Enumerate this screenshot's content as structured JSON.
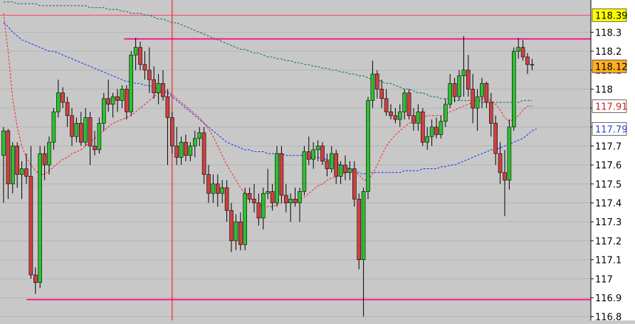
{
  "chart_data": {
    "type": "candlestick",
    "title": "",
    "xlabel": "",
    "ylabel": "",
    "ylim": [
      116.78,
      118.47
    ],
    "y_ticks": [
      "118.3",
      "118.2",
      "118.1",
      "118",
      "117.9",
      "117.8",
      "117.7",
      "117.6",
      "117.5",
      "117.4",
      "117.3",
      "117.2",
      "117.1",
      "117",
      "116.9",
      "116.8"
    ],
    "grid": true,
    "price_badges": [
      {
        "label": "118.39",
        "value": 118.39,
        "bg": "#ffff00",
        "fg": "#000000"
      },
      {
        "label": "118.12",
        "value": 118.12,
        "bg": "#ffb020",
        "fg": "#000000"
      },
      {
        "label": "117.91",
        "value": 117.91,
        "bg": "#ffffff",
        "fg": "#d02020"
      },
      {
        "label": "117.79",
        "value": 117.79,
        "bg": "#ffffff",
        "fg": "#3040d0"
      }
    ],
    "horizontal_lines": [
      {
        "value": 118.39,
        "color": "#ff4060",
        "from": 0.0,
        "width": 1
      },
      {
        "value": 118.265,
        "color": "#ff1493",
        "from": 0.21,
        "width": 2
      },
      {
        "value": 116.89,
        "color": "#ff1493",
        "from": 0.045,
        "width": 2
      }
    ],
    "vertical_marker_candle": 37,
    "colors": {
      "background": "#c8c8c8",
      "grid": "#b4b4b4",
      "up": "#2fc02f",
      "down": "#d04040",
      "wick": "#000000",
      "ma_fast": "#ff2020",
      "ma_mid": "#1030ff",
      "ma_slow": "#107050",
      "marker": "#ff0000"
    },
    "candles": [
      {
        "o": 117.65,
        "h": 117.8,
        "l": 117.4,
        "c": 117.78
      },
      {
        "o": 117.78,
        "h": 117.79,
        "l": 117.42,
        "c": 117.5
      },
      {
        "o": 117.5,
        "h": 117.72,
        "l": 117.45,
        "c": 117.7
      },
      {
        "o": 117.7,
        "h": 117.72,
        "l": 117.48,
        "c": 117.55
      },
      {
        "o": 117.55,
        "h": 117.62,
        "l": 117.42,
        "c": 117.58
      },
      {
        "o": 117.58,
        "h": 117.66,
        "l": 117.5,
        "c": 117.54
      },
      {
        "o": 117.54,
        "h": 117.7,
        "l": 117.0,
        "c": 117.02
      },
      {
        "o": 117.02,
        "h": 117.06,
        "l": 116.92,
        "c": 116.98
      },
      {
        "o": 116.98,
        "h": 117.7,
        "l": 116.95,
        "c": 117.66
      },
      {
        "o": 117.66,
        "h": 117.7,
        "l": 117.52,
        "c": 117.6
      },
      {
        "o": 117.6,
        "h": 117.75,
        "l": 117.55,
        "c": 117.72
      },
      {
        "o": 117.72,
        "h": 117.9,
        "l": 117.68,
        "c": 117.88
      },
      {
        "o": 117.88,
        "h": 118.05,
        "l": 117.85,
        "c": 117.98
      },
      {
        "o": 117.98,
        "h": 118.01,
        "l": 117.9,
        "c": 117.93
      },
      {
        "o": 117.93,
        "h": 117.96,
        "l": 117.8,
        "c": 117.86
      },
      {
        "o": 117.86,
        "h": 117.9,
        "l": 117.7,
        "c": 117.75
      },
      {
        "o": 117.75,
        "h": 117.85,
        "l": 117.72,
        "c": 117.82
      },
      {
        "o": 117.82,
        "h": 117.88,
        "l": 117.7,
        "c": 117.72
      },
      {
        "o": 117.72,
        "h": 117.9,
        "l": 117.7,
        "c": 117.85
      },
      {
        "o": 117.85,
        "h": 117.88,
        "l": 117.6,
        "c": 117.7
      },
      {
        "o": 117.7,
        "h": 117.78,
        "l": 117.65,
        "c": 117.68
      },
      {
        "o": 117.68,
        "h": 117.85,
        "l": 117.66,
        "c": 117.82
      },
      {
        "o": 117.82,
        "h": 117.98,
        "l": 117.78,
        "c": 117.95
      },
      {
        "o": 117.95,
        "h": 118.05,
        "l": 117.88,
        "c": 117.92
      },
      {
        "o": 117.92,
        "h": 117.98,
        "l": 117.85,
        "c": 117.96
      },
      {
        "o": 117.96,
        "h": 118.0,
        "l": 117.88,
        "c": 117.94
      },
      {
        "o": 117.94,
        "h": 118.02,
        "l": 117.9,
        "c": 118.0
      },
      {
        "o": 118.0,
        "h": 118.02,
        "l": 117.84,
        "c": 117.88
      },
      {
        "o": 117.88,
        "h": 118.2,
        "l": 117.86,
        "c": 118.18
      },
      {
        "o": 118.18,
        "h": 118.27,
        "l": 118.1,
        "c": 118.22
      },
      {
        "o": 118.22,
        "h": 118.25,
        "l": 118.1,
        "c": 118.13
      },
      {
        "o": 118.13,
        "h": 118.2,
        "l": 118.05,
        "c": 118.1
      },
      {
        "o": 118.1,
        "h": 118.22,
        "l": 117.98,
        "c": 118.05
      },
      {
        "o": 118.05,
        "h": 118.12,
        "l": 117.95,
        "c": 117.98
      },
      {
        "o": 117.98,
        "h": 118.08,
        "l": 117.92,
        "c": 118.03
      },
      {
        "o": 118.03,
        "h": 118.1,
        "l": 117.94,
        "c": 117.96
      },
      {
        "o": 117.96,
        "h": 118.0,
        "l": 117.6,
        "c": 117.85
      },
      {
        "o": 117.85,
        "h": 117.88,
        "l": 117.66,
        "c": 117.7
      },
      {
        "o": 117.7,
        "h": 117.8,
        "l": 117.6,
        "c": 117.64
      },
      {
        "o": 117.64,
        "h": 117.75,
        "l": 117.6,
        "c": 117.72
      },
      {
        "o": 117.72,
        "h": 117.76,
        "l": 117.62,
        "c": 117.65
      },
      {
        "o": 117.65,
        "h": 117.72,
        "l": 117.62,
        "c": 117.7
      },
      {
        "o": 117.7,
        "h": 117.78,
        "l": 117.64,
        "c": 117.74
      },
      {
        "o": 117.74,
        "h": 117.8,
        "l": 117.7,
        "c": 117.77
      },
      {
        "o": 117.77,
        "h": 117.8,
        "l": 117.5,
        "c": 117.55
      },
      {
        "o": 117.55,
        "h": 117.6,
        "l": 117.4,
        "c": 117.45
      },
      {
        "o": 117.45,
        "h": 117.55,
        "l": 117.4,
        "c": 117.5
      },
      {
        "o": 117.5,
        "h": 117.55,
        "l": 117.38,
        "c": 117.45
      },
      {
        "o": 117.45,
        "h": 117.52,
        "l": 117.4,
        "c": 117.48
      },
      {
        "o": 117.48,
        "h": 117.52,
        "l": 117.3,
        "c": 117.36
      },
      {
        "o": 117.36,
        "h": 117.4,
        "l": 117.14,
        "c": 117.2
      },
      {
        "o": 117.2,
        "h": 117.34,
        "l": 117.15,
        "c": 117.3
      },
      {
        "o": 117.3,
        "h": 117.35,
        "l": 117.15,
        "c": 117.18
      },
      {
        "o": 117.18,
        "h": 117.48,
        "l": 117.15,
        "c": 117.45
      },
      {
        "o": 117.45,
        "h": 117.48,
        "l": 117.4,
        "c": 117.42
      },
      {
        "o": 117.42,
        "h": 117.5,
        "l": 117.35,
        "c": 117.4
      },
      {
        "o": 117.4,
        "h": 117.45,
        "l": 117.28,
        "c": 117.32
      },
      {
        "o": 117.32,
        "h": 117.48,
        "l": 117.26,
        "c": 117.45
      },
      {
        "o": 117.45,
        "h": 117.58,
        "l": 117.42,
        "c": 117.46
      },
      {
        "o": 117.46,
        "h": 117.5,
        "l": 117.36,
        "c": 117.4
      },
      {
        "o": 117.4,
        "h": 117.7,
        "l": 117.38,
        "c": 117.66
      },
      {
        "o": 117.66,
        "h": 117.7,
        "l": 117.4,
        "c": 117.44
      },
      {
        "o": 117.44,
        "h": 117.5,
        "l": 117.35,
        "c": 117.4
      },
      {
        "o": 117.4,
        "h": 117.45,
        "l": 117.3,
        "c": 117.42
      },
      {
        "o": 117.42,
        "h": 117.48,
        "l": 117.38,
        "c": 117.4
      },
      {
        "o": 117.4,
        "h": 117.48,
        "l": 117.3,
        "c": 117.46
      },
      {
        "o": 117.46,
        "h": 117.7,
        "l": 117.44,
        "c": 117.67
      },
      {
        "o": 117.67,
        "h": 117.75,
        "l": 117.6,
        "c": 117.63
      },
      {
        "o": 117.63,
        "h": 117.72,
        "l": 117.58,
        "c": 117.68
      },
      {
        "o": 117.68,
        "h": 117.73,
        "l": 117.62,
        "c": 117.7
      },
      {
        "o": 117.7,
        "h": 117.72,
        "l": 117.6,
        "c": 117.62
      },
      {
        "o": 117.62,
        "h": 117.66,
        "l": 117.54,
        "c": 117.58
      },
      {
        "o": 117.58,
        "h": 117.7,
        "l": 117.56,
        "c": 117.66
      },
      {
        "o": 117.66,
        "h": 117.68,
        "l": 117.5,
        "c": 117.54
      },
      {
        "o": 117.54,
        "h": 117.62,
        "l": 117.5,
        "c": 117.6
      },
      {
        "o": 117.6,
        "h": 117.65,
        "l": 117.52,
        "c": 117.56
      },
      {
        "o": 117.56,
        "h": 117.62,
        "l": 117.52,
        "c": 117.58
      },
      {
        "o": 117.58,
        "h": 117.62,
        "l": 117.38,
        "c": 117.42
      },
      {
        "o": 117.42,
        "h": 117.45,
        "l": 117.05,
        "c": 117.1
      },
      {
        "o": 117.1,
        "h": 117.48,
        "l": 116.8,
        "c": 117.46
      },
      {
        "o": 117.46,
        "h": 117.96,
        "l": 117.42,
        "c": 117.94
      },
      {
        "o": 117.94,
        "h": 118.15,
        "l": 117.9,
        "c": 118.08
      },
      {
        "o": 118.08,
        "h": 118.1,
        "l": 117.95,
        "c": 118.0
      },
      {
        "o": 118.0,
        "h": 118.05,
        "l": 117.9,
        "c": 117.95
      },
      {
        "o": 117.95,
        "h": 118.0,
        "l": 117.86,
        "c": 117.88
      },
      {
        "o": 117.88,
        "h": 117.92,
        "l": 117.84,
        "c": 117.86
      },
      {
        "o": 117.86,
        "h": 117.9,
        "l": 117.82,
        "c": 117.84
      },
      {
        "o": 117.84,
        "h": 117.92,
        "l": 117.8,
        "c": 117.88
      },
      {
        "o": 117.88,
        "h": 118.0,
        "l": 117.84,
        "c": 117.98
      },
      {
        "o": 117.98,
        "h": 118.0,
        "l": 117.84,
        "c": 117.86
      },
      {
        "o": 117.86,
        "h": 117.9,
        "l": 117.78,
        "c": 117.82
      },
      {
        "o": 117.82,
        "h": 117.92,
        "l": 117.78,
        "c": 117.88
      },
      {
        "o": 117.88,
        "h": 117.9,
        "l": 117.7,
        "c": 117.72
      },
      {
        "o": 117.72,
        "h": 117.8,
        "l": 117.68,
        "c": 117.75
      },
      {
        "o": 117.75,
        "h": 117.84,
        "l": 117.7,
        "c": 117.8
      },
      {
        "o": 117.8,
        "h": 117.85,
        "l": 117.74,
        "c": 117.76
      },
      {
        "o": 117.76,
        "h": 117.86,
        "l": 117.74,
        "c": 117.83
      },
      {
        "o": 117.83,
        "h": 117.95,
        "l": 117.8,
        "c": 117.92
      },
      {
        "o": 117.92,
        "h": 118.08,
        "l": 117.9,
        "c": 118.03
      },
      {
        "o": 118.03,
        "h": 118.06,
        "l": 117.93,
        "c": 117.96
      },
      {
        "o": 117.96,
        "h": 118.1,
        "l": 117.94,
        "c": 118.07
      },
      {
        "o": 118.07,
        "h": 118.28,
        "l": 117.96,
        "c": 118.1
      },
      {
        "o": 118.1,
        "h": 118.18,
        "l": 117.96,
        "c": 118.0
      },
      {
        "o": 118.0,
        "h": 118.08,
        "l": 117.82,
        "c": 117.9
      },
      {
        "o": 117.9,
        "h": 118.0,
        "l": 117.78,
        "c": 117.96
      },
      {
        "o": 117.96,
        "h": 118.06,
        "l": 117.9,
        "c": 118.03
      },
      {
        "o": 118.03,
        "h": 118.04,
        "l": 117.9,
        "c": 117.93
      },
      {
        "o": 117.93,
        "h": 117.98,
        "l": 117.75,
        "c": 117.82
      },
      {
        "o": 117.82,
        "h": 117.86,
        "l": 117.6,
        "c": 117.66
      },
      {
        "o": 117.66,
        "h": 117.72,
        "l": 117.5,
        "c": 117.56
      },
      {
        "o": 117.56,
        "h": 117.68,
        "l": 117.33,
        "c": 117.52
      },
      {
        "o": 117.52,
        "h": 117.84,
        "l": 117.47,
        "c": 117.8
      },
      {
        "o": 117.8,
        "h": 118.22,
        "l": 117.78,
        "c": 118.2
      },
      {
        "o": 118.2,
        "h": 118.27,
        "l": 118.16,
        "c": 118.22
      },
      {
        "o": 118.22,
        "h": 118.26,
        "l": 118.15,
        "c": 118.17
      },
      {
        "o": 118.17,
        "h": 118.19,
        "l": 118.08,
        "c": 118.13
      },
      {
        "o": 118.13,
        "h": 118.16,
        "l": 118.1,
        "c": 118.13
      }
    ],
    "ma_fast": [
      118.4,
      118.2,
      117.95,
      117.8,
      117.7,
      117.64,
      117.6,
      117.57,
      117.55,
      117.55,
      117.57,
      117.59,
      117.61,
      117.63,
      117.64,
      117.66,
      117.67,
      117.68,
      117.7,
      117.72,
      117.74,
      117.76,
      117.78,
      117.8,
      117.82,
      117.83,
      117.84,
      117.85,
      117.86,
      117.88,
      117.9,
      117.92,
      117.94,
      117.96,
      117.98,
      117.99,
      117.99,
      117.97,
      117.95,
      117.93,
      117.91,
      117.89,
      117.87,
      117.85,
      117.82,
      117.79,
      117.75,
      117.7,
      117.65,
      117.6,
      117.56,
      117.52,
      117.48,
      117.45,
      117.43,
      117.41,
      117.39,
      117.38,
      117.38,
      117.38,
      117.39,
      117.4,
      117.4,
      117.41,
      117.41,
      117.42,
      117.43,
      117.45,
      117.47,
      117.49,
      117.5,
      117.52,
      117.53,
      117.54,
      117.55,
      117.56,
      117.56,
      117.56,
      117.55,
      117.52,
      117.52,
      117.55,
      117.6,
      117.65,
      117.7,
      117.73,
      117.76,
      117.78,
      117.8,
      117.82,
      117.83,
      117.84,
      117.85,
      117.86,
      117.86,
      117.86,
      117.86,
      117.87,
      117.88,
      117.89,
      117.9,
      117.91,
      117.92,
      117.93,
      117.94,
      117.95,
      117.95,
      117.94,
      117.92,
      117.89,
      117.85,
      117.83,
      117.84,
      117.86,
      117.89,
      117.91,
      117.91
    ],
    "ma_mid": [
      118.35,
      118.33,
      118.3,
      118.28,
      118.26,
      118.25,
      118.24,
      118.23,
      118.22,
      118.21,
      118.2,
      118.2,
      118.19,
      118.18,
      118.17,
      118.16,
      118.15,
      118.14,
      118.13,
      118.12,
      118.11,
      118.1,
      118.09,
      118.08,
      118.07,
      118.06,
      118.05,
      118.04,
      118.04,
      118.03,
      118.03,
      118.02,
      118.02,
      118.01,
      118.0,
      117.99,
      117.98,
      117.96,
      117.94,
      117.92,
      117.9,
      117.88,
      117.86,
      117.84,
      117.82,
      117.8,
      117.78,
      117.76,
      117.74,
      117.72,
      117.71,
      117.7,
      117.69,
      117.68,
      117.68,
      117.67,
      117.67,
      117.67,
      117.66,
      117.66,
      117.66,
      117.66,
      117.65,
      117.65,
      117.65,
      117.65,
      117.65,
      117.64,
      117.64,
      117.64,
      117.63,
      117.63,
      117.62,
      117.61,
      117.6,
      117.59,
      117.58,
      117.57,
      117.56,
      117.55,
      117.56,
      117.56,
      117.56,
      117.56,
      117.56,
      117.56,
      117.56,
      117.56,
      117.57,
      117.57,
      117.57,
      117.57,
      117.58,
      117.58,
      117.58,
      117.58,
      117.59,
      117.59,
      117.6,
      117.6,
      117.61,
      117.62,
      117.63,
      117.64,
      117.65,
      117.66,
      117.67,
      117.68,
      117.68,
      117.69,
      117.7,
      117.71,
      117.72,
      117.73,
      117.74,
      117.76,
      117.78,
      117.79
    ],
    "ma_slow": [
      118.46,
      118.46,
      118.46,
      118.45,
      118.45,
      118.45,
      118.45,
      118.45,
      118.44,
      118.44,
      118.44,
      118.44,
      118.44,
      118.44,
      118.44,
      118.44,
      118.44,
      118.44,
      118.44,
      118.43,
      118.43,
      118.43,
      118.43,
      118.42,
      118.42,
      118.42,
      118.41,
      118.41,
      118.4,
      118.4,
      118.4,
      118.39,
      118.39,
      118.38,
      118.37,
      118.37,
      118.36,
      118.35,
      118.35,
      118.34,
      118.33,
      118.32,
      118.31,
      118.3,
      118.29,
      118.28,
      118.27,
      118.26,
      118.25,
      118.24,
      118.23,
      118.22,
      118.21,
      118.21,
      118.2,
      118.19,
      118.19,
      118.18,
      118.17,
      118.17,
      118.16,
      118.16,
      118.15,
      118.15,
      118.14,
      118.14,
      118.13,
      118.13,
      118.12,
      118.12,
      118.11,
      118.11,
      118.1,
      118.1,
      118.09,
      118.09,
      118.08,
      118.08,
      118.07,
      118.07,
      118.06,
      118.05,
      118.05,
      118.04,
      118.03,
      118.03,
      118.02,
      118.01,
      118.0,
      118.0,
      117.99,
      117.98,
      117.98,
      117.97,
      117.96,
      117.96,
      117.95,
      117.95,
      117.95,
      117.94,
      117.94,
      117.94,
      117.94,
      117.94,
      117.94,
      117.93,
      117.93,
      117.93,
      117.93,
      117.93,
      117.93,
      117.93,
      117.93,
      117.93,
      117.94,
      117.94,
      117.94
    ]
  }
}
